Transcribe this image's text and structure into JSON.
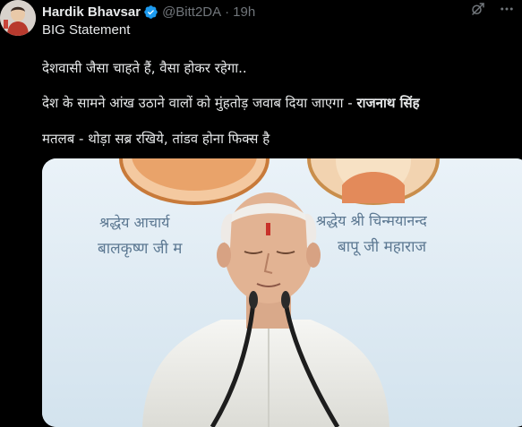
{
  "tweet": {
    "author_name": "Hardik Bhavsar",
    "handle": "@Bitt2DA",
    "separator": "·",
    "time": "19h",
    "line1": "BIG Statement",
    "line2": "देशवासी जैसा चाहते हैं, वैसा होकर रहेगा..",
    "line3_a": "देश के सामने आंख उठाने वालों को मुंहतोड़ जवाब दिया जाएगा - ",
    "line3_b": "राजनाथ सिंह",
    "line4": "मतलब - थोड़ा सब्र रखिये, तांडव होना फिक्स है"
  },
  "media": {
    "caption_left_1": "श्रद्धेय आचार्य",
    "caption_left_2": "बालकृष्ण जी म",
    "caption_right_1": "श्रद्धेय श्री चिन्मयानन्द",
    "caption_right_2": "बापू जी महाराज"
  },
  "colors": {
    "background": "#000000",
    "text": "#e7e9ea",
    "muted": "#71767b",
    "verified": "#1d9bf0"
  }
}
